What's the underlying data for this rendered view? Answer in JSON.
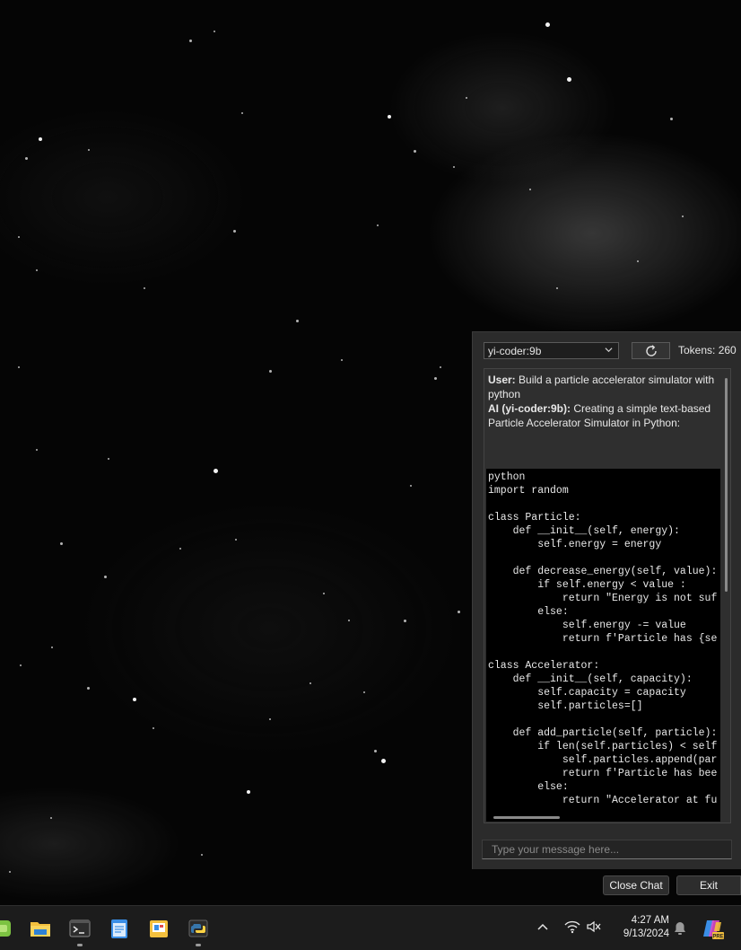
{
  "chat": {
    "model_selected": "yi-coder:9b",
    "tokens_label": "Tokens: 260",
    "messages": [
      {
        "role_label": "User:",
        "text": "Build a particle accelerator simulator with python"
      },
      {
        "role_label": "AI (yi-coder:9b):",
        "text": "Creating a simple text-based Particle Accelerator Simulator in Python:"
      }
    ],
    "code_lines": "python\nimport random\n\nclass Particle:\n    def __init__(self, energy):\n        self.energy = energy\n\n    def decrease_energy(self, value):\n        if self.energy < value :\n            return \"Energy is not suf\n        else:\n            self.energy -= value\n            return f'Particle has {se\n\nclass Accelerator:\n    def __init__(self, capacity):\n        self.capacity = capacity\n        self.particles=[]\n\n    def add_particle(self, particle):\n        if len(self.particles) < self\n            self.particles.append(par\n            return f'Particle has bee\n        else:\n            return \"Accelerator at fu",
    "input_placeholder": "Type your message here...",
    "close_chat_label": "Close Chat",
    "exit_label": "Exit"
  },
  "taskbar": {
    "apps": [
      "app-icon-green",
      "file-explorer-icon",
      "terminal-icon",
      "notepad-icon",
      "file-manager-icon",
      "python-icon"
    ],
    "time": "4:27 AM",
    "date": "9/13/2024",
    "copilot_badge": "PRE"
  }
}
